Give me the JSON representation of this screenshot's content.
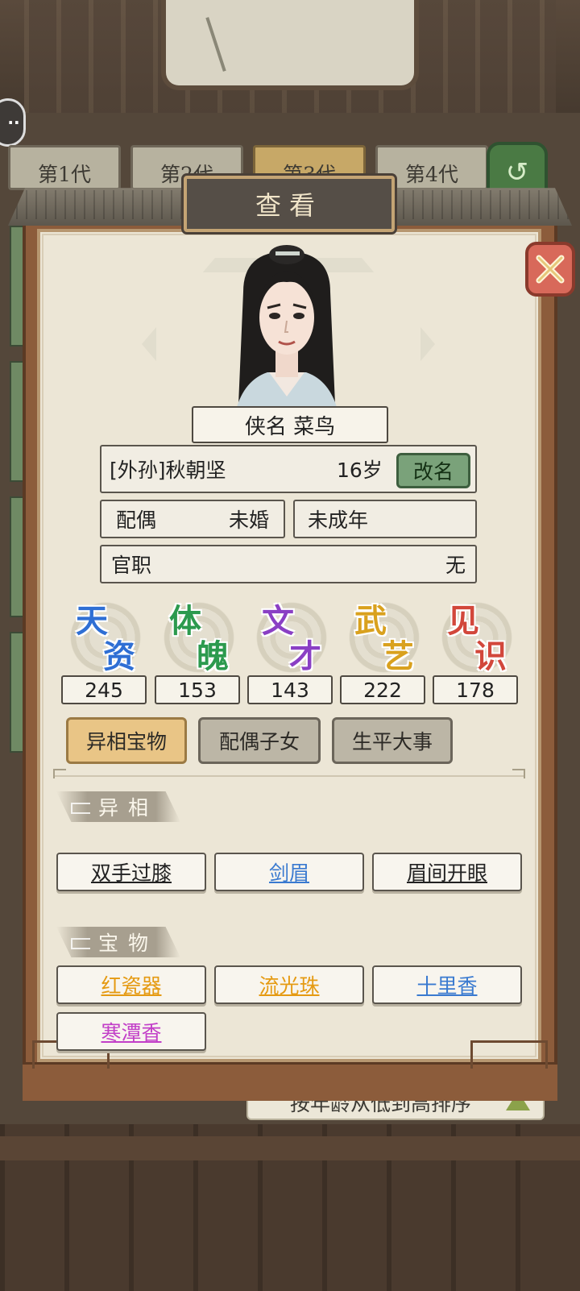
{
  "background": {
    "generation_tabs": [
      "第1代",
      "第2代",
      "第3代",
      "第4代"
    ],
    "active_generation": 2,
    "sort_label": "按年龄从低到高排序"
  },
  "dialog": {
    "title": "查看",
    "hero_name": "侠名 菜鸟",
    "identity": "[外孙]秋朝坚",
    "age": "16岁",
    "rename_label": "改名",
    "spouse_label": "配偶",
    "spouse_value": "未婚",
    "adult_status": "未成年",
    "office_label": "官职",
    "office_value": "无"
  },
  "stats": [
    {
      "c1": "天",
      "c2": "资",
      "value": "245",
      "color": "#2f6fd4"
    },
    {
      "c1": "体",
      "c2": "魄",
      "value": "153",
      "color": "#2c9a4e"
    },
    {
      "c1": "文",
      "c2": "才",
      "value": "143",
      "color": "#8a3fc4"
    },
    {
      "c1": "武",
      "c2": "艺",
      "value": "222",
      "color": "#d9a11e"
    },
    {
      "c1": "见",
      "c2": "识",
      "value": "178",
      "color": "#d2473b"
    }
  ],
  "tabs": [
    "异相宝物",
    "配偶子女",
    "生平大事"
  ],
  "active_tab": 0,
  "sections": {
    "traits_title": "异相",
    "treasures_title": "宝物"
  },
  "traits": [
    {
      "label": "双手过膝",
      "color": "#222222"
    },
    {
      "label": "剑眉",
      "color": "#3a7ad0"
    },
    {
      "label": "眉间开眼",
      "color": "#222222"
    }
  ],
  "treasures": [
    {
      "label": "红瓷器",
      "color": "#e59a12"
    },
    {
      "label": "流光珠",
      "color": "#e59a12"
    },
    {
      "label": "十里香",
      "color": "#3a7ad0"
    },
    {
      "label": "寒潭香",
      "color": "#c23fc8"
    }
  ],
  "icons": {
    "close": "close-x-icon",
    "refresh": "refresh-arrow-icon",
    "sort": "triangle-up-icon",
    "menu": "chat-bubble-icon"
  }
}
